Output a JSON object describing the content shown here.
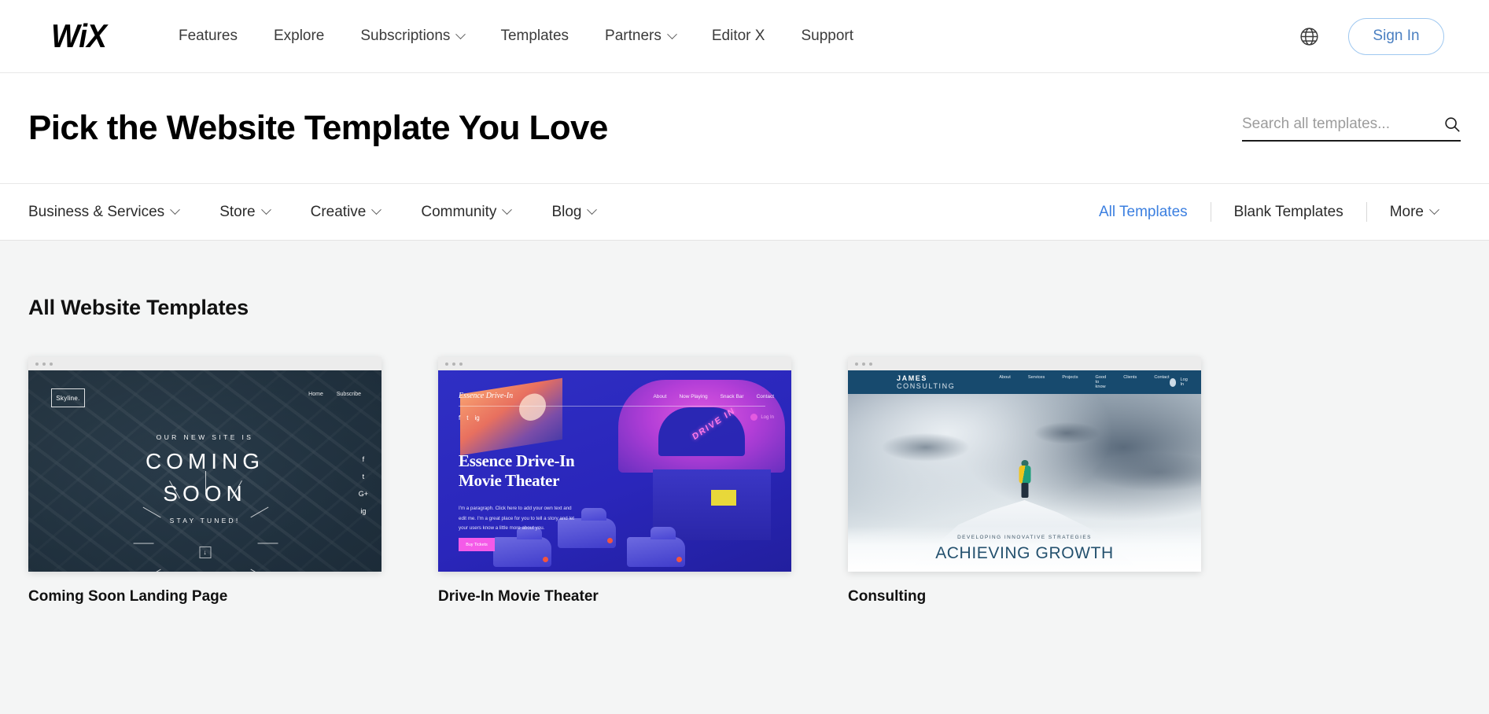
{
  "topbar": {
    "progress_color": "#4ba0da"
  },
  "nav": {
    "logo": "WiX",
    "links": [
      {
        "label": "Features",
        "has_caret": false
      },
      {
        "label": "Explore",
        "has_caret": false
      },
      {
        "label": "Subscriptions",
        "has_caret": true
      },
      {
        "label": "Templates",
        "has_caret": false
      },
      {
        "label": "Partners",
        "has_caret": true
      },
      {
        "label": "Editor X",
        "has_caret": false
      },
      {
        "label": "Support",
        "has_caret": false
      }
    ],
    "globe_icon": "globe-icon",
    "sign_in": "Sign In",
    "sign_in_color": "#4a7fc1"
  },
  "header": {
    "title": "Pick the Website Template You Love",
    "search_placeholder": "Search all templates...",
    "search_value": "",
    "search_icon": "search-icon"
  },
  "categories": [
    {
      "label": "Business & Services",
      "has_caret": true
    },
    {
      "label": "Store",
      "has_caret": true
    },
    {
      "label": "Creative",
      "has_caret": true
    },
    {
      "label": "Community",
      "has_caret": true
    },
    {
      "label": "Blog",
      "has_caret": true
    }
  ],
  "filters": [
    {
      "label": "All Templates",
      "active": true,
      "has_caret": false
    },
    {
      "label": "Blank Templates",
      "active": false,
      "has_caret": false
    },
    {
      "label": "More",
      "active": false,
      "has_caret": true
    }
  ],
  "filter_active_color": "#3b7fe0",
  "main": {
    "section_title": "All Website Templates"
  },
  "cards": [
    {
      "title": "Coming Soon Landing Page",
      "logo": "Skyline.",
      "nav": [
        "Home",
        "Subscribe"
      ],
      "kicker": "OUR NEW SITE IS",
      "headline_line1": "COMING",
      "headline_line2": "SOON",
      "subline": "STAY TUNED!",
      "social": [
        "f",
        "t",
        "G+",
        "ig"
      ],
      "scroll_icon": "down-arrow-icon"
    },
    {
      "title": "Drive-In Movie Theater",
      "brand": "Essence Drive-In",
      "nav": [
        "About",
        "Now Playing",
        "Snack Bar",
        "Contact"
      ],
      "login": "Log In",
      "headline_line1": "Essence Drive-In",
      "headline_line2": "Movie Theater",
      "paragraph": "I'm a paragraph. Click here to add your own text and edit me. I'm a great place for you to tell a story and let your users know a little more about you.",
      "button": "Buy Tickets",
      "sign_text": "DRIVE IN",
      "social": [
        "f",
        "t",
        "ig"
      ]
    },
    {
      "title": "Consulting",
      "brand_bold": "JAMES",
      "brand_light": "CONSULTING",
      "nav": [
        "About",
        "Services",
        "Projects",
        "Good to know",
        "Clients",
        "Contact"
      ],
      "login": "Log In",
      "kicker": "DEVELOPING INNOVATIVE STRATEGIES",
      "headline": "ACHIEVING GROWTH"
    }
  ]
}
